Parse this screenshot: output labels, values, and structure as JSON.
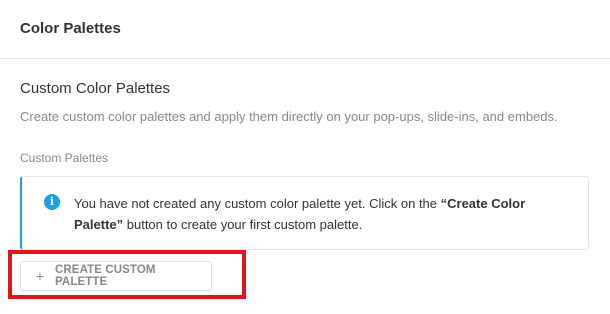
{
  "header": {
    "title": "Color Palettes"
  },
  "section": {
    "title": "Custom Color Palettes",
    "description": "Create custom color palettes and apply them directly on your pop-ups, slide-ins, and embeds.",
    "field_label": "Custom Palettes"
  },
  "notice": {
    "icon": "info-icon",
    "text_before": "You have not created any custom color palette yet. Click on the ",
    "text_bold": "“Create Color Palette”",
    "text_after": " button to create your first custom palette."
  },
  "create_button": {
    "icon": "plus-icon",
    "label": "CREATE CUSTOM PALETTE"
  },
  "colors": {
    "accent": "#1ba0e1",
    "highlight": "#e3141f",
    "muted_text": "#888888"
  }
}
